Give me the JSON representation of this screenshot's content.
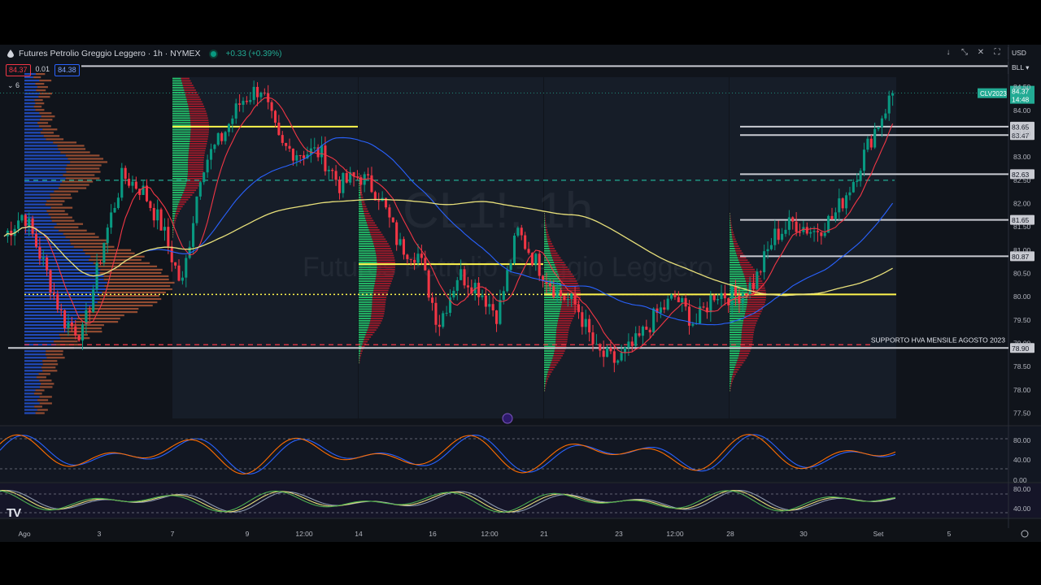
{
  "header": {
    "title": "Futures Petrolio Greggio Leggero · 1h · NYMEX",
    "change": "+0.33 (+0.39%)",
    "bid": "84.37",
    "spread": "0.01",
    "ask": "84.38",
    "indicator_count": "6",
    "currency": "USD",
    "unit": "BLL"
  },
  "watermark": {
    "symbol": "CL1!, 1h",
    "name": "Futures Petrolio Greggio Leggero"
  },
  "colors": {
    "bull": "#089981",
    "bear": "#f23645",
    "sma_fast": "#f23645",
    "sma_mid": "#2962ff",
    "sma_slow": "#e8e07a",
    "poc": "#fff64d",
    "level": "#c9cbd2",
    "stoch_k": "#2962ff",
    "stoch_d": "#ff6d00"
  },
  "chart_data": {
    "type": "candlestick",
    "symbol": "CLV2023",
    "exchange": "NYMEX",
    "interval": "1h",
    "last_price": "84.37",
    "countdown": "14:48",
    "ylim": [
      77.3,
      84.8
    ],
    "y_ticks": [
      "84.50",
      "84.00",
      "83.50",
      "83.00",
      "82.50",
      "82.00",
      "81.50",
      "81.00",
      "80.50",
      "80.00",
      "79.50",
      "79.00",
      "78.50",
      "78.00",
      "77.50"
    ],
    "x_ticks": [
      "Ago",
      "3",
      "7",
      "9",
      "12:00",
      "14",
      "16",
      "12:00",
      "21",
      "23",
      "12:00",
      "28",
      "30",
      "Set",
      "5"
    ],
    "horizontal_levels": [
      {
        "price": 84.95,
        "label": ""
      },
      {
        "price": 83.65,
        "label": "83.65"
      },
      {
        "price": 83.47,
        "label": "83.47"
      },
      {
        "price": 82.63,
        "label": "82.63"
      },
      {
        "price": 81.65,
        "label": "81.65"
      },
      {
        "price": 80.87,
        "label": "80.87"
      },
      {
        "price": 78.9,
        "label": "78.90"
      }
    ],
    "annotation": "SUPPORTO HVA MENSILE AGOSTO 2023",
    "poc_levels": [
      83.65,
      80.7,
      80.05
    ],
    "close_path": [
      {
        "x": "Ago",
        "y": 81.3
      },
      {
        "x": "2",
        "y": 81.8
      },
      {
        "x": "2 12:00",
        "y": 80.7
      },
      {
        "x": "3",
        "y": 79.5
      },
      {
        "x": "3 12:00",
        "y": 79.2
      },
      {
        "x": "4",
        "y": 81.1
      },
      {
        "x": "7",
        "y": 82.6
      },
      {
        "x": "7 12:00",
        "y": 82.3
      },
      {
        "x": "8",
        "y": 81.5
      },
      {
        "x": "8 12:00",
        "y": 80.2
      },
      {
        "x": "9",
        "y": 82.8
      },
      {
        "x": "9 12:00",
        "y": 83.4
      },
      {
        "x": "10",
        "y": 84.2
      },
      {
        "x": "10 12:00",
        "y": 84.5
      },
      {
        "x": "11",
        "y": 83.2
      },
      {
        "x": "11 12:00",
        "y": 83.1
      },
      {
        "x": "14",
        "y": 83.1
      },
      {
        "x": "14 12:00",
        "y": 82.4
      },
      {
        "x": "15",
        "y": 82.6
      },
      {
        "x": "15 12:00",
        "y": 82.2
      },
      {
        "x": "16",
        "y": 81.1
      },
      {
        "x": "16 12:00",
        "y": 80.9
      },
      {
        "x": "17",
        "y": 79.4
      },
      {
        "x": "17 12:00",
        "y": 80.5
      },
      {
        "x": "18",
        "y": 80.2
      },
      {
        "x": "18 12:00",
        "y": 79.6
      },
      {
        "x": "21",
        "y": 81.4
      },
      {
        "x": "21 12:00",
        "y": 80.7
      },
      {
        "x": "22",
        "y": 80.1
      },
      {
        "x": "22 12:00",
        "y": 79.8
      },
      {
        "x": "23",
        "y": 78.8
      },
      {
        "x": "23 12:00",
        "y": 78.6
      },
      {
        "x": "24",
        "y": 79.0
      },
      {
        "x": "24 12:00",
        "y": 79.6
      },
      {
        "x": "25",
        "y": 80.0
      },
      {
        "x": "25 12:00",
        "y": 79.4
      },
      {
        "x": "28",
        "y": 80.1
      },
      {
        "x": "28 12:00",
        "y": 80.0
      },
      {
        "x": "29",
        "y": 80.3
      },
      {
        "x": "29 12:00",
        "y": 81.3
      },
      {
        "x": "30",
        "y": 81.6
      },
      {
        "x": "30 12:00",
        "y": 81.4
      },
      {
        "x": "31",
        "y": 81.7
      },
      {
        "x": "31 12:00",
        "y": 82.5
      },
      {
        "x": "Set",
        "y": 83.5
      },
      {
        "x": "Set 12:00",
        "y": 84.37
      }
    ],
    "oscillators": [
      {
        "name": "",
        "ticks": [
          "80.00",
          "40.00",
          "0.00"
        ]
      },
      {
        "name": "",
        "ticks": [
          "80.00",
          "40.00"
        ]
      }
    ]
  }
}
